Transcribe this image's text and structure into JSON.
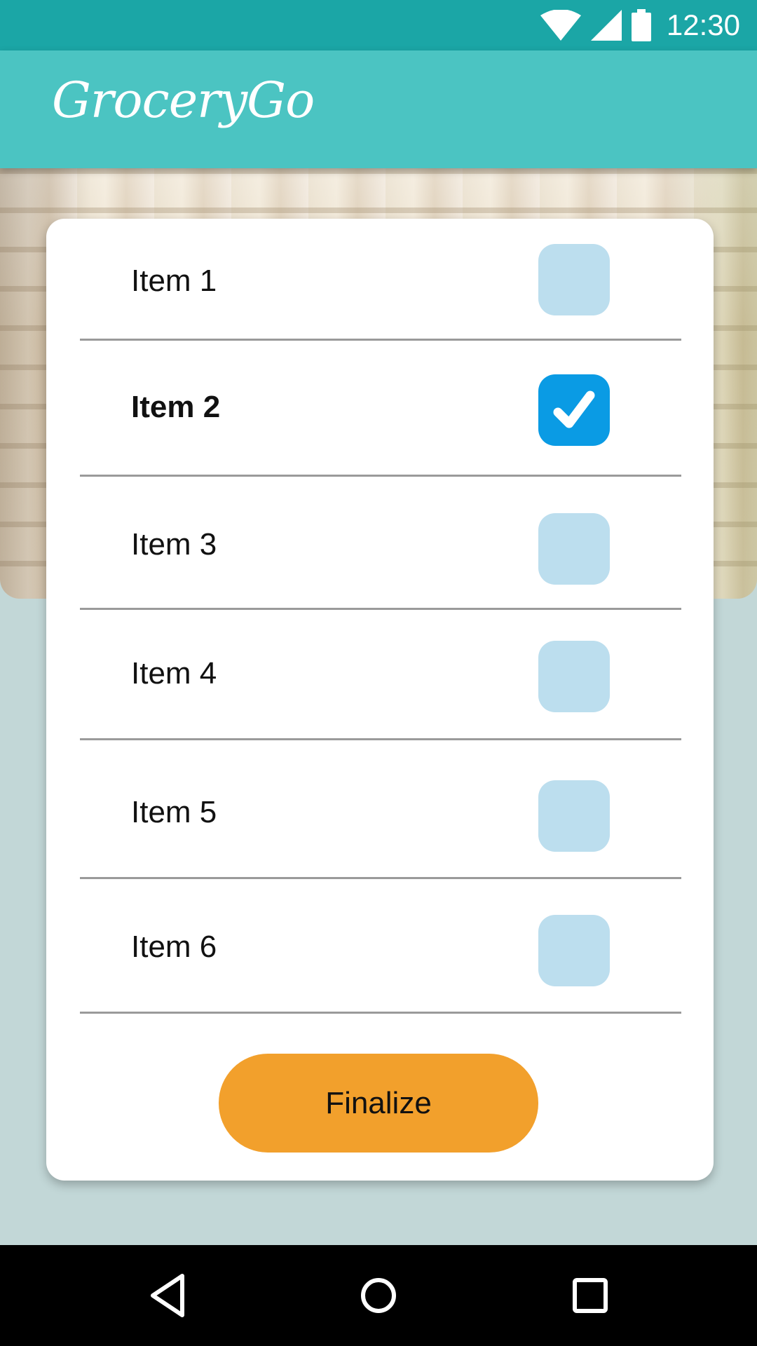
{
  "status_bar": {
    "time": "12:30",
    "icons": [
      "wifi-icon",
      "cellular-signal-icon",
      "battery-icon"
    ],
    "color": "#1ba6a6"
  },
  "app_bar": {
    "title": "GroceryGo",
    "color": "#4bc4c2"
  },
  "list": {
    "items": [
      {
        "label": "Item 1",
        "checked": false
      },
      {
        "label": "Item 2",
        "checked": true
      },
      {
        "label": "Item 3",
        "checked": false
      },
      {
        "label": "Item 4",
        "checked": false
      },
      {
        "label": "Item 5",
        "checked": false
      },
      {
        "label": "Item 6",
        "checked": false
      }
    ],
    "checkbox_unchecked_color": "#bcdeee",
    "checkbox_checked_color": "#0a9be4"
  },
  "finalize_button": {
    "label": "Finalize",
    "color": "#f2a02c"
  },
  "nav_bar": {
    "buttons": [
      "back-icon",
      "home-icon",
      "recents-icon"
    ]
  }
}
